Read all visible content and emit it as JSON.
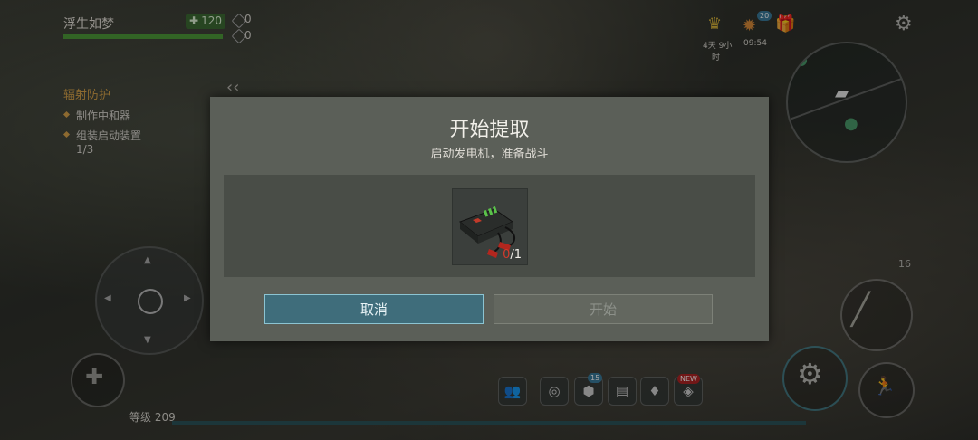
{
  "player": {
    "name": "浮生如梦",
    "health": "120",
    "stat1": "0",
    "stat2": "0",
    "health_fraction": 1.0
  },
  "quest": {
    "title": "辐射防护",
    "items": [
      "制作中和器",
      "组装启动装置"
    ],
    "progress": "1/3"
  },
  "hud": {
    "timer_line1": "4天 9小",
    "timer_line2": "时",
    "clock": "09:54",
    "gift_badge": "20",
    "weapon_ammo": "16",
    "level_label": "等级 209",
    "notification_count": "15",
    "new_badge": "NEW"
  },
  "dialog": {
    "title": "开始提取",
    "subtitle": "启动发电机，准备战斗",
    "item": {
      "name": "battery-jump-starter",
      "have": "0",
      "need": "/1"
    },
    "cancel_label": "取消",
    "start_label": "开始"
  },
  "colors": {
    "cancel_button": "#3f6d7b",
    "start_button_disabled": "#63675f",
    "dialog_bg": "#5b5f58",
    "quest_title": "#d9a44a"
  }
}
